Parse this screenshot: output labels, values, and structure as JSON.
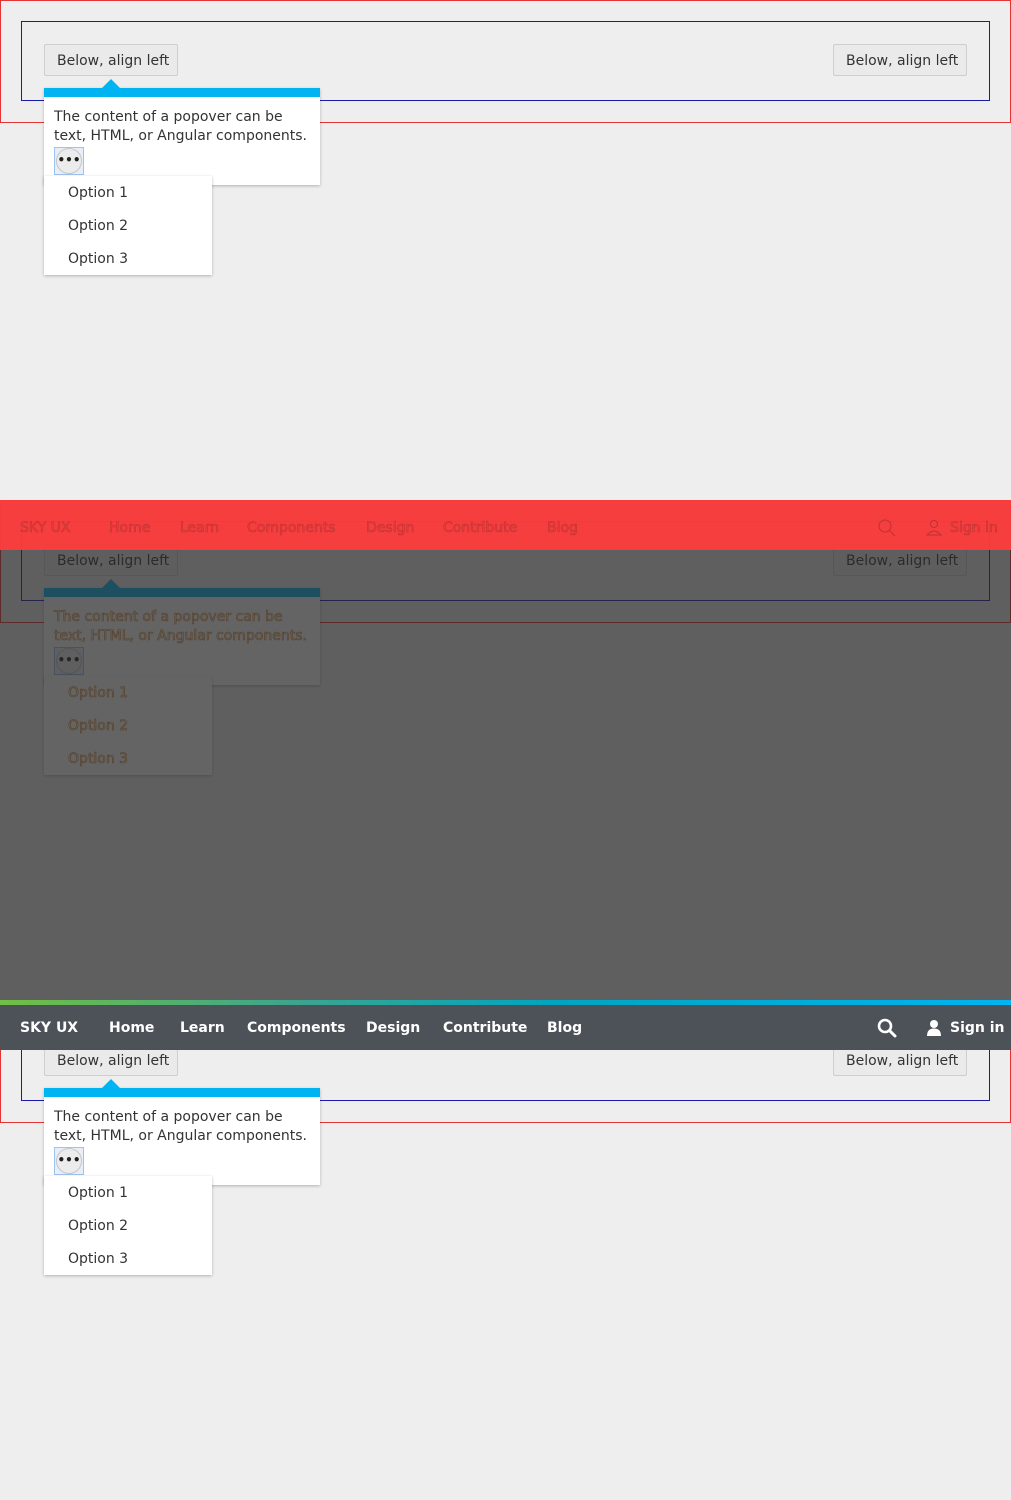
{
  "popover": {
    "button_left_label": "Below, align left",
    "button_right_label": "Below, align left",
    "content": "The content of a popover can be text, HTML, or Angular components.",
    "ellipsis": "•••"
  },
  "dropdown": {
    "items": [
      "Option 1",
      "Option 2",
      "Option 3"
    ]
  },
  "navbar": {
    "brand": "SKY UX",
    "items": [
      "Home",
      "Learn",
      "Components",
      "Design",
      "Contribute",
      "Blog"
    ],
    "sign_in": "Sign in",
    "search_icon": "search-icon",
    "user_icon": "user-icon"
  },
  "colors": {
    "popover_accent": "#00b4f1",
    "navbar_bg": "#4d5259",
    "stripe_green": "#71bf43",
    "stripe_blue": "#00b4f1",
    "frame_red": "#e63333",
    "frame_blue": "#1a1aa6"
  }
}
